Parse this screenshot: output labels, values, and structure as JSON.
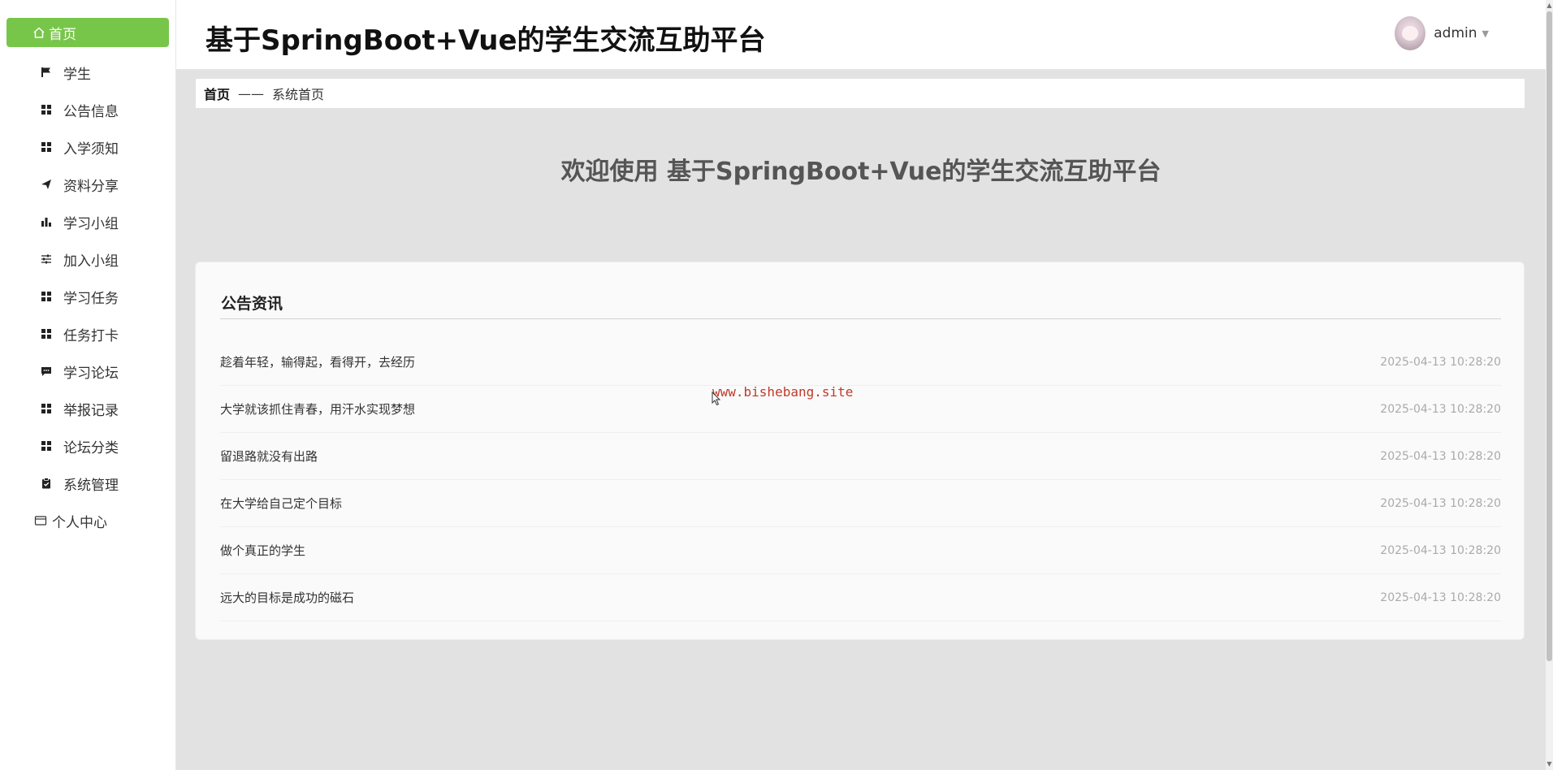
{
  "app": {
    "title": "基于SpringBoot+Vue的学生交流互助平台"
  },
  "sidebar": {
    "home_label": "首页",
    "items": [
      {
        "label": "学生",
        "icon": "flag-icon"
      },
      {
        "label": "公告信息",
        "icon": "grid-icon"
      },
      {
        "label": "入学须知",
        "icon": "grid-icon"
      },
      {
        "label": "资料分享",
        "icon": "send-icon"
      },
      {
        "label": "学习小组",
        "icon": "bar-chart-icon"
      },
      {
        "label": "加入小组",
        "icon": "sliders-icon"
      },
      {
        "label": "学习任务",
        "icon": "grid-icon"
      },
      {
        "label": "任务打卡",
        "icon": "grid-icon"
      },
      {
        "label": "学习论坛",
        "icon": "chat-icon"
      },
      {
        "label": "举报记录",
        "icon": "grid-icon"
      },
      {
        "label": "论坛分类",
        "icon": "grid-icon"
      },
      {
        "label": "系统管理",
        "icon": "clipboard-icon"
      }
    ],
    "personal_label": "个人中心"
  },
  "header": {
    "username": "admin"
  },
  "breadcrumb": {
    "home": "首页",
    "separator": "——",
    "current": "系统首页"
  },
  "welcome": "欢迎使用 基于SpringBoot+Vue的学生交流互助平台",
  "news": {
    "title": "公告资讯",
    "items": [
      {
        "text": "趁着年轻，输得起，看得开，去经历",
        "time": "2025-04-13 10:28:20"
      },
      {
        "text": "大学就该抓住青春，用汗水实现梦想",
        "time": "2025-04-13 10:28:20"
      },
      {
        "text": "留退路就没有出路",
        "time": "2025-04-13 10:28:20"
      },
      {
        "text": "在大学给自己定个目标",
        "time": "2025-04-13 10:28:20"
      },
      {
        "text": "做个真正的学生",
        "time": "2025-04-13 10:28:20"
      },
      {
        "text": "远大的目标是成功的磁石",
        "time": "2025-04-13 10:28:20"
      }
    ]
  },
  "watermark": "www.bishebang.site",
  "colors": {
    "accent": "#77c64a",
    "watermark": "#c0392b"
  }
}
